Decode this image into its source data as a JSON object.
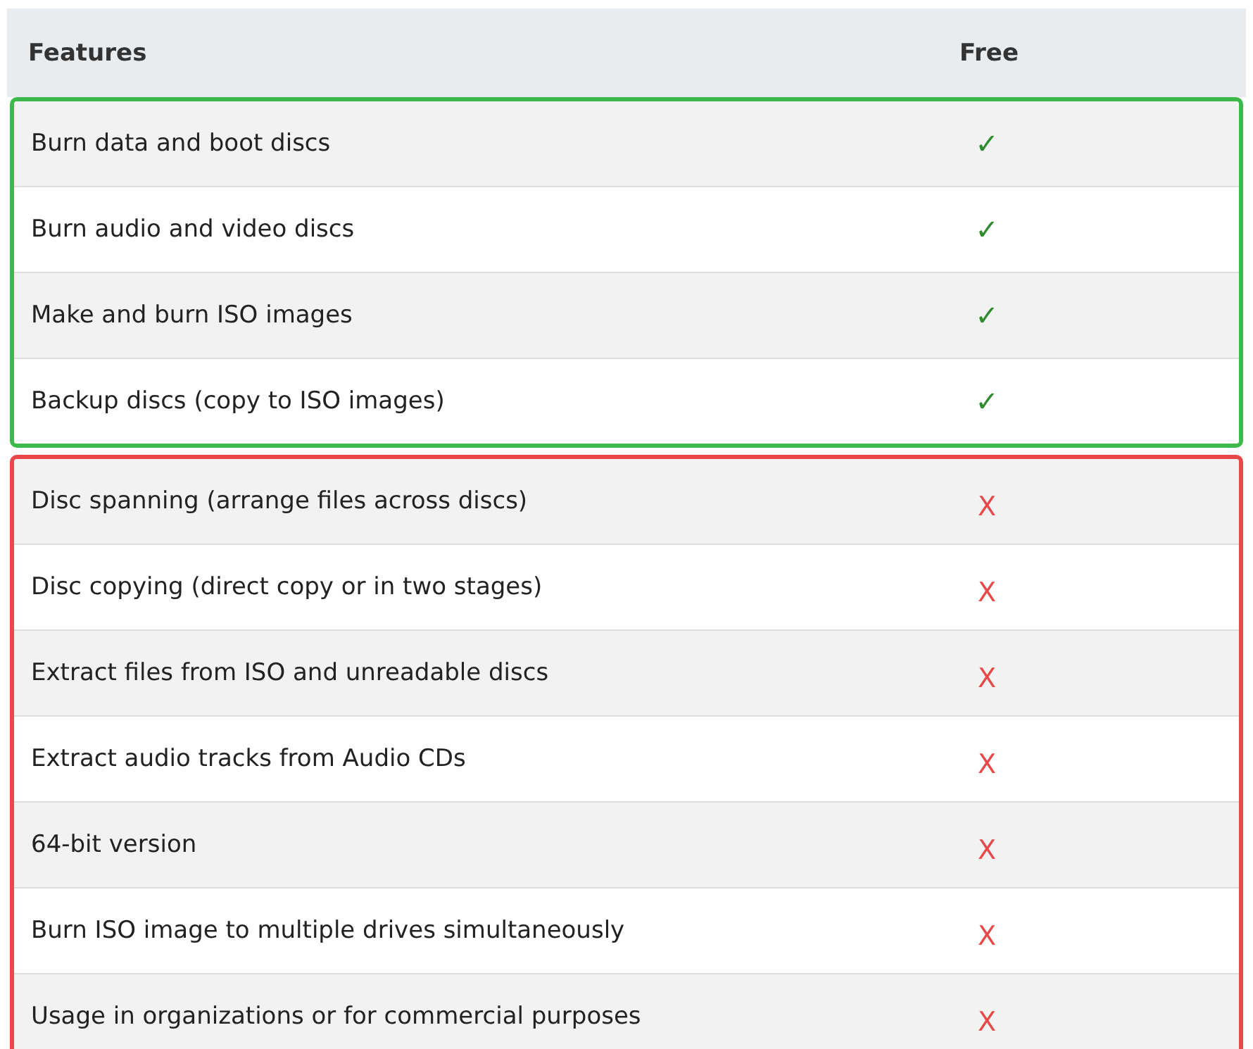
{
  "table": {
    "columns": [
      "Features",
      "Free"
    ],
    "groups": [
      {
        "color": "#3cb94a",
        "rows": [
          {
            "feature": "Burn data and boot discs",
            "free": "✓",
            "kind": "yes"
          },
          {
            "feature": "Burn audio and video discs",
            "free": "✓",
            "kind": "yes"
          },
          {
            "feature": "Make and burn ISO images",
            "free": "✓",
            "kind": "yes"
          },
          {
            "feature": "Backup discs (copy to ISO images)",
            "free": "✓",
            "kind": "yes"
          }
        ]
      },
      {
        "color": "#e84848",
        "rows": [
          {
            "feature": "Disc spanning (arrange files across discs)",
            "free": "X",
            "kind": "no"
          },
          {
            "feature": "Disc copying (direct copy or in two stages)",
            "free": "X",
            "kind": "no"
          },
          {
            "feature": "Extract files from ISO and unreadable discs",
            "free": "X",
            "kind": "no"
          },
          {
            "feature": "Extract audio tracks from Audio CDs",
            "free": "X",
            "kind": "no"
          },
          {
            "feature": "64-bit version",
            "free": "X",
            "kind": "no"
          },
          {
            "feature": "Burn ISO image to multiple drives simultaneously",
            "free": "X",
            "kind": "no"
          },
          {
            "feature": "Usage in organizations or for commercial purposes",
            "free": "X",
            "kind": "no"
          }
        ]
      }
    ]
  }
}
